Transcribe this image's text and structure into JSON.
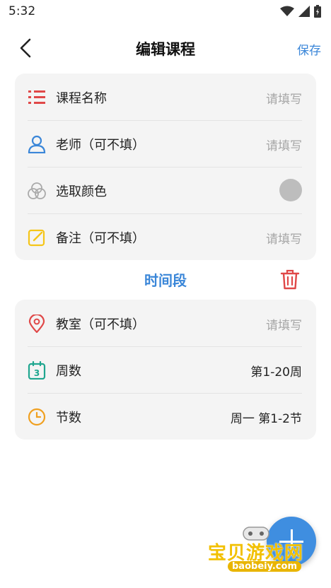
{
  "status_bar": {
    "time": "5:32"
  },
  "header": {
    "title": "编辑课程",
    "save_label": "保存"
  },
  "course_card": {
    "name_row": {
      "label": "课程名称",
      "placeholder": "请填写",
      "icon": "list-icon"
    },
    "teacher_row": {
      "label": "老师（可不填）",
      "placeholder": "请填写",
      "icon": "person-icon"
    },
    "color_row": {
      "label": "选取颜色",
      "icon": "color-circles-icon",
      "swatch_color": "#bdbdbd"
    },
    "note_row": {
      "label": "备注（可不填）",
      "placeholder": "请填写",
      "icon": "edit-note-icon"
    }
  },
  "time_section": {
    "title": "时间段",
    "delete_icon": "trash-icon"
  },
  "time_card": {
    "room_row": {
      "label": "教室（可不填）",
      "placeholder": "请填写",
      "icon": "location-pin-icon"
    },
    "weeks_row": {
      "label": "周数",
      "value": "第1-20周",
      "icon": "calendar-icon",
      "icon_text": "3"
    },
    "periods_row": {
      "label": "节数",
      "value": "周一 第1-2节",
      "icon": "clock-icon"
    }
  },
  "fab": {
    "icon": "plus-icon"
  },
  "watermark": {
    "text": "宝贝游戏网",
    "url": "baobeiy.com"
  },
  "colors": {
    "accent": "#3a86d8",
    "red": "#e04848",
    "yellow": "#f5c518",
    "teal": "#1fa68f",
    "orange": "#f0a020"
  }
}
